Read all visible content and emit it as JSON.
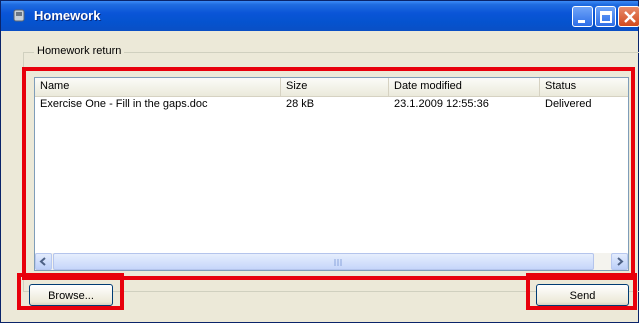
{
  "window": {
    "title": "Homework"
  },
  "group": {
    "label": "Homework return"
  },
  "list": {
    "columns": [
      "Name",
      "Size",
      "Date modified",
      "Status"
    ],
    "rows": [
      {
        "name": "Exercise One - Fill in the gaps.doc",
        "size": "28 kB",
        "date_modified": "23.1.2009 12:55:36",
        "status": "Delivered"
      }
    ]
  },
  "buttons": {
    "browse": "Browse...",
    "send": "Send"
  },
  "colors": {
    "highlight": "#e8000c",
    "titlebar": "#0a55d8",
    "face": "#ece9d8"
  }
}
